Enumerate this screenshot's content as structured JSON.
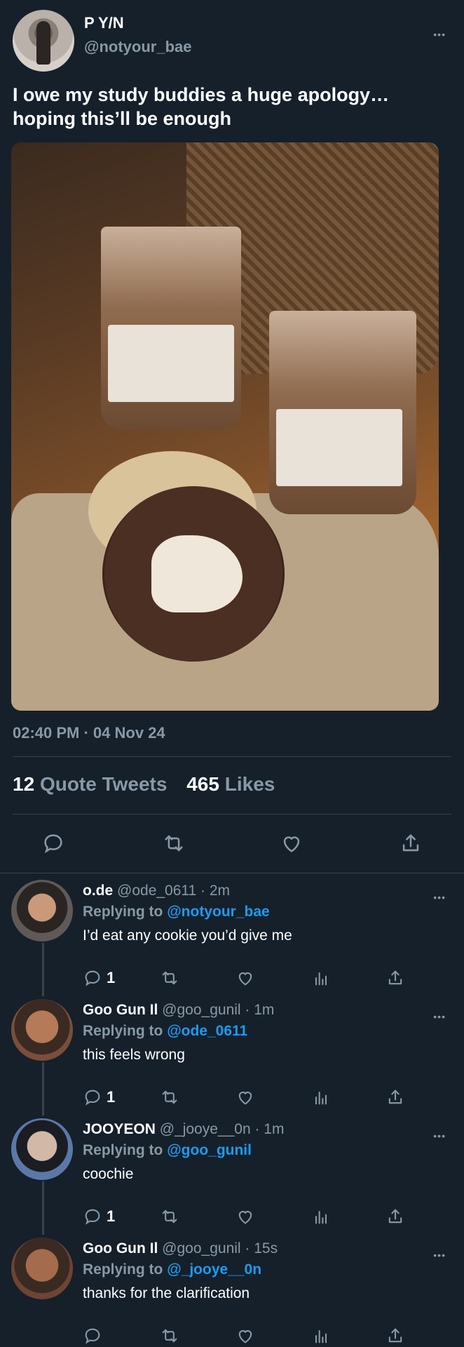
{
  "tweet": {
    "name": "P Y/N",
    "handle": "@notyour_bae",
    "text": "I owe my study buddies a huge apology… hoping this’ll be enough",
    "timestamp": "02:40 PM · 04 Nov 24",
    "quote_tweets_count": "12",
    "quote_tweets_label": "Quote Tweets",
    "likes_count": "465",
    "likes_label": "Likes"
  },
  "replies": [
    {
      "name": "o.de",
      "meta": "@ode_0611 · 2m",
      "replying_label": "Replying to",
      "replying_to": "@notyour_bae",
      "text": "I’d eat any cookie you’d give me",
      "reply_count": "1"
    },
    {
      "name": "Goo Gun Il",
      "meta": "@goo_gunil · 1m",
      "replying_label": "Replying to",
      "replying_to": "@ode_0611",
      "text": "this feels wrong",
      "reply_count": "1"
    },
    {
      "name": "JOOYEON",
      "meta": "@_jooye__0n · 1m",
      "replying_label": "Replying to",
      "replying_to": "@goo_gunil",
      "text": "coochie",
      "reply_count": "1"
    },
    {
      "name": "Goo Gun Il",
      "meta": "@goo_gunil · 15s",
      "replying_label": "Replying to",
      "replying_to": "@_jooye__0n",
      "text": "thanks for the clarification",
      "reply_count": ""
    }
  ],
  "colors": {
    "background": "#15202b",
    "muted": "#8899a6",
    "link": "#1d9bf0",
    "divider": "#38444d"
  },
  "icons": [
    "more-icon",
    "reply-icon",
    "retweet-icon",
    "like-icon",
    "share-icon",
    "analytics-icon"
  ]
}
